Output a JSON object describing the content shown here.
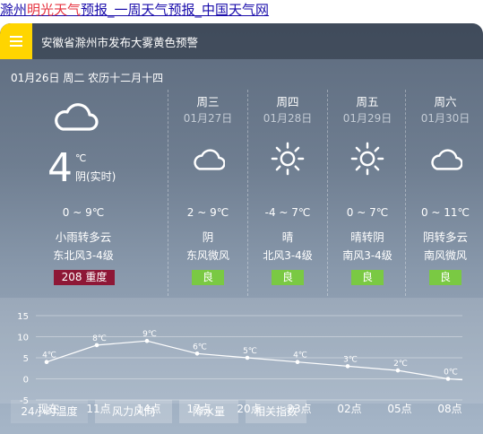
{
  "page_title": {
    "prefix": "滁州",
    "highlight": "明光天气",
    "rest": "预报_一周天气预报_中国天气网"
  },
  "alert": {
    "text": "安徽省滁州市发布大雾黄色预警",
    "menu_icon": "hamburger-icon",
    "menu_color": "#ffd500"
  },
  "today": {
    "date_line": "01月26日 周二 农历十二月十四",
    "temp": "4",
    "unit": "℃",
    "realtime_label": "阴(实时)",
    "range": "0 ~ 9℃",
    "weather": "小雨转多云",
    "wind": "东北风3-4级",
    "aqi": "208 重度",
    "aqi_color": "#8e1736",
    "icon": "cloud-icon"
  },
  "forecast": [
    {
      "day": "周三",
      "date": "01月27日",
      "icon": "cloud-icon",
      "range": "2 ~ 9℃",
      "weather": "阴",
      "wind": "东风微风",
      "quality": "良"
    },
    {
      "day": "周四",
      "date": "01月28日",
      "icon": "sun-icon",
      "range": "-4 ~ 7℃",
      "weather": "晴",
      "wind": "北风3-4级",
      "quality": "良"
    },
    {
      "day": "周五",
      "date": "01月29日",
      "icon": "sun-icon",
      "range": "0 ~ 7℃",
      "weather": "晴转阴",
      "wind": "南风3-4级",
      "quality": "良"
    },
    {
      "day": "周六",
      "date": "01月30日",
      "icon": "cloud-icon",
      "range": "0 ~ 11℃",
      "weather": "阴转多云",
      "wind": "南风微风",
      "quality": "良"
    }
  ],
  "quality_color": "#7ac943",
  "chart_data": {
    "type": "line",
    "categories": [
      "现在",
      "11点",
      "14点",
      "17点",
      "20点",
      "23点",
      "02点",
      "05点",
      "08点"
    ],
    "values": [
      4,
      8,
      9,
      6,
      5,
      4,
      3,
      2,
      0
    ],
    "point_labels": [
      "4℃",
      "8℃",
      "9℃",
      "6℃",
      "5℃",
      "4℃",
      "3℃",
      "2℃",
      "0℃"
    ],
    "yticks": [
      "15",
      "10",
      "5",
      "0",
      "-5"
    ],
    "ylim": [
      -5,
      15
    ],
    "grid": true
  },
  "tabs": [
    "24小时温度",
    "风力风向",
    "降水量",
    "相关指数"
  ]
}
